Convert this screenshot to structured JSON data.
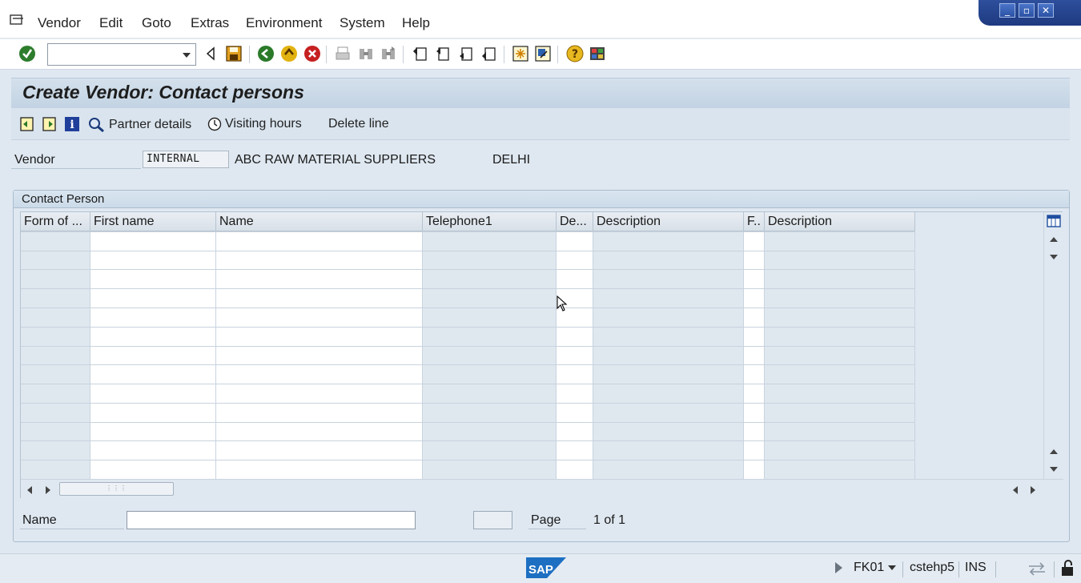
{
  "menu": {
    "items": [
      "Vendor",
      "Edit",
      "Goto",
      "Extras",
      "Environment",
      "System",
      "Help"
    ]
  },
  "window_controls": [
    "minimize",
    "restore",
    "close"
  ],
  "toolbar": {
    "command_field": {
      "value": "",
      "placeholder": ""
    },
    "icons": [
      "enter-icon",
      "back-arrow-icon",
      "save-icon",
      "back-icon",
      "exit-icon",
      "cancel-icon",
      "print-icon",
      "find-icon",
      "find-next-icon",
      "first-page-icon",
      "previous-page-icon",
      "next-page-icon",
      "last-page-icon",
      "create-session-icon",
      "create-shortcut-icon",
      "help-icon",
      "customize-layout-icon"
    ]
  },
  "title": "Create Vendor: Contact persons",
  "app_toolbar": {
    "partner_details": "Partner details",
    "visiting_hours": "Visiting hours",
    "delete_line": "Delete line"
  },
  "vendor": {
    "label": "Vendor",
    "code": "INTERNAL",
    "name": "ABC RAW MATERIAL SUPPLIERS",
    "city": "DELHI"
  },
  "contact_group": {
    "title": "Contact Person",
    "columns": [
      "Form of ...",
      "First name",
      "Name",
      "Telephone1",
      "De...",
      "Description",
      "F..",
      "Description"
    ],
    "rows": [
      [
        "",
        "",
        "",
        "",
        "",
        "",
        "",
        ""
      ],
      [
        "",
        "",
        "",
        "",
        "",
        "",
        "",
        ""
      ],
      [
        "",
        "",
        "",
        "",
        "",
        "",
        "",
        ""
      ],
      [
        "",
        "",
        "",
        "",
        "",
        "",
        "",
        ""
      ],
      [
        "",
        "",
        "",
        "",
        "",
        "",
        "",
        ""
      ],
      [
        "",
        "",
        "",
        "",
        "",
        "",
        "",
        ""
      ],
      [
        "",
        "",
        "",
        "",
        "",
        "",
        "",
        ""
      ],
      [
        "",
        "",
        "",
        "",
        "",
        "",
        "",
        ""
      ],
      [
        "",
        "",
        "",
        "",
        "",
        "",
        "",
        ""
      ],
      [
        "",
        "",
        "",
        "",
        "",
        "",
        "",
        ""
      ],
      [
        "",
        "",
        "",
        "",
        "",
        "",
        "",
        ""
      ],
      [
        "",
        "",
        "",
        "",
        "",
        "",
        "",
        ""
      ],
      [
        "",
        "",
        "",
        "",
        "",
        "",
        "",
        ""
      ]
    ]
  },
  "footer": {
    "name_label": "Name",
    "name_value": "",
    "page_input_value": "",
    "page_label": "Page",
    "page_count": "1 of   1"
  },
  "status_bar": {
    "tcode": "FK01",
    "server": "cstehp5",
    "mode": "INS"
  },
  "colors": {
    "title_bar": "#c3d3e3",
    "grid_grey_column": "#dfe7ef",
    "window_controls": "#1e3a80",
    "sap_logo": "#1d6fc2"
  }
}
